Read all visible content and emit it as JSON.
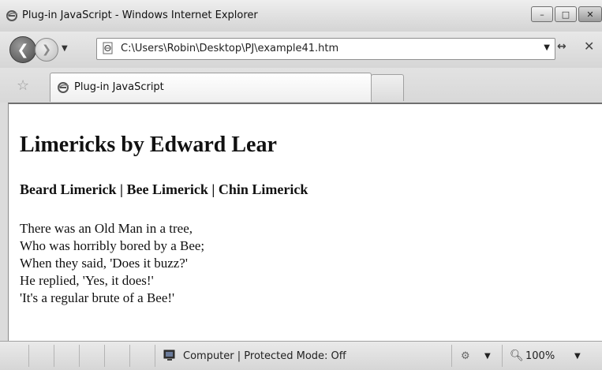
{
  "window": {
    "title": "Plug-in JavaScript - Windows Internet Explorer",
    "minimize": "–",
    "maximize": "□",
    "close": "✕"
  },
  "navbar": {
    "back_glyph": "❮",
    "forward_glyph": "❯",
    "history_dropdown": "▼",
    "address": "C:\\Users\\Robin\\Desktop\\PJ\\example41.htm",
    "address_dropdown": "▼",
    "refresh_glyph": "↔",
    "stop_glyph": "✕"
  },
  "tabs": {
    "favorites_glyph": "☆",
    "items": [
      {
        "label": "Plug-in JavaScript"
      }
    ]
  },
  "page": {
    "heading": "Limericks by Edward Lear",
    "links": [
      "Beard Limerick",
      "Bee Limerick",
      "Chin Limerick"
    ],
    "separator": " | ",
    "poem": [
      "There was an Old Man in a tree,",
      "Who was horribly bored by a Bee;",
      "When they said, 'Does it buzz?'",
      "He replied, 'Yes, it does!'",
      "'It's a regular brute of a Bee!'"
    ]
  },
  "statusbar": {
    "zone": "Computer | Protected Mode: Off",
    "security_dropdown": "▼",
    "zoom": "100%",
    "zoom_dropdown": "▼"
  }
}
